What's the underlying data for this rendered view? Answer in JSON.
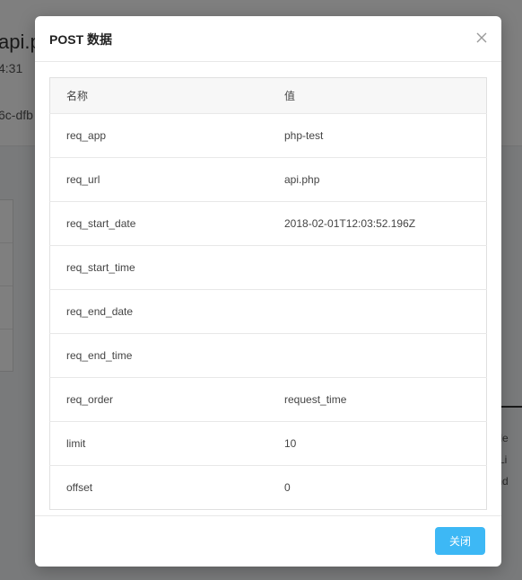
{
  "background": {
    "title": "api.p",
    "time": "4:31",
    "id": "6c-dfb",
    "right_fragments": [
      "oade",
      "estLi",
      "ound"
    ]
  },
  "modal": {
    "title": "POST 数据",
    "close_icon": "close-icon",
    "columns": [
      "名称",
      "值"
    ],
    "rows": [
      {
        "name": "req_app",
        "value": "php-test"
      },
      {
        "name": "req_url",
        "value": "api.php"
      },
      {
        "name": "req_start_date",
        "value": "2018-02-01T12:03:52.196Z"
      },
      {
        "name": "req_start_time",
        "value": ""
      },
      {
        "name": "req_end_date",
        "value": ""
      },
      {
        "name": "req_end_time",
        "value": ""
      },
      {
        "name": "req_order",
        "value": "request_time"
      },
      {
        "name": "limit",
        "value": "10"
      },
      {
        "name": "offset",
        "value": "0"
      }
    ],
    "close_button_label": "关闭"
  },
  "colors": {
    "primary": "#3db8f5",
    "overlay": "rgba(0,0,0,0.5)"
  }
}
